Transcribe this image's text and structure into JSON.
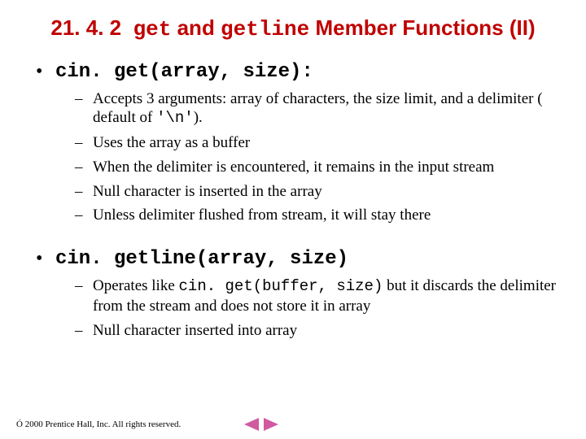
{
  "title": {
    "section_number": "21. 4. 2",
    "part1": "get",
    "middle": " and ",
    "part2": "getline",
    "suffix": " Member Functions (II)"
  },
  "bullets": [
    {
      "heading": "cin. get(array, size):",
      "subs": [
        {
          "pre": "Accepts 3 arguments: array of characters, the size limit, and a delimiter ( default of ",
          "code": "'\\n'",
          "post": ")."
        },
        {
          "pre": "Uses the array as a buffer",
          "code": "",
          "post": ""
        },
        {
          "pre": "When the delimiter is encountered, it remains in the input stream",
          "code": "",
          "post": ""
        },
        {
          "pre": "Null character is inserted in the array",
          "code": "",
          "post": ""
        },
        {
          "pre": "Unless delimiter flushed from stream, it will stay there",
          "code": "",
          "post": ""
        }
      ]
    },
    {
      "heading": "cin. getline(array, size)",
      "subs": [
        {
          "pre": "Operates like ",
          "code": "cin. get(buffer, size)",
          "post": " but it discards the delimiter from the stream and does not store it in array"
        },
        {
          "pre": "Null character inserted into array",
          "code": "",
          "post": ""
        }
      ]
    }
  ],
  "footer": "Ó 2000 Prentice Hall, Inc. All rights reserved.",
  "nav": {
    "prev_color": "#d05aa0",
    "next_color": "#d05aa0"
  }
}
